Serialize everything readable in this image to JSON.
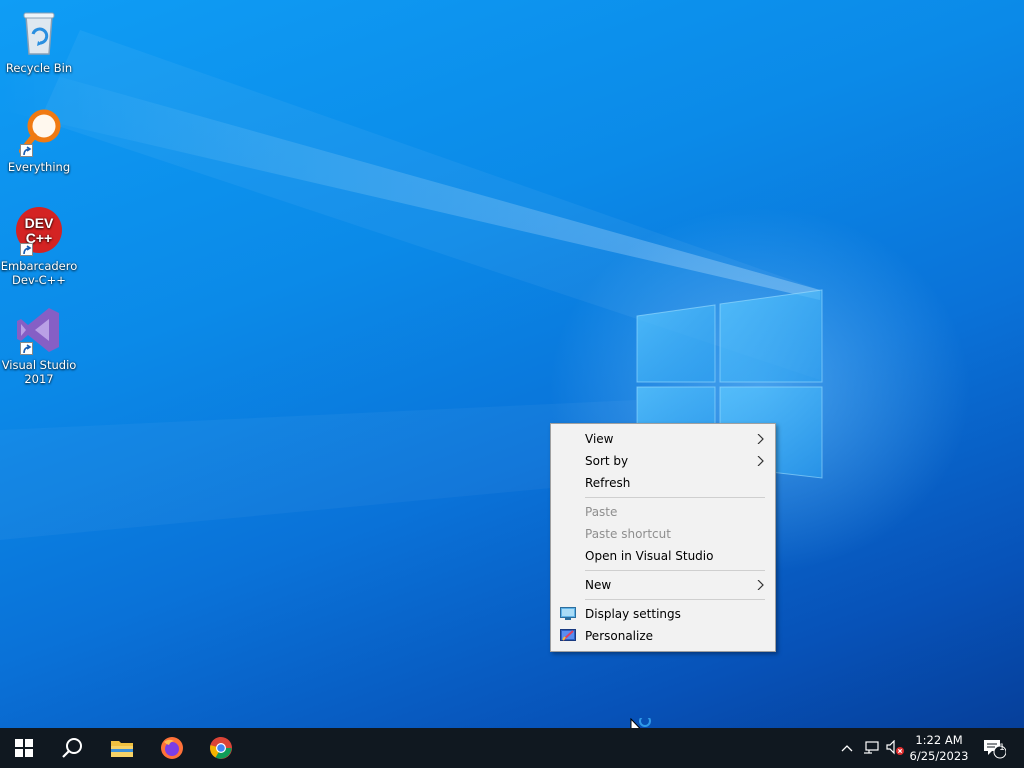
{
  "desktop": {
    "icons": [
      {
        "label": "Recycle Bin",
        "icon": "recycle-bin-icon"
      },
      {
        "label": "Everything",
        "icon": "everything-search-icon"
      },
      {
        "label": "Embarcadero Dev-C++",
        "icon": "dev-cpp-icon",
        "glyph_line1": "DEV",
        "glyph_line2": "C++"
      },
      {
        "label": "Visual Studio 2017",
        "icon": "visual-studio-icon"
      }
    ]
  },
  "context_menu": {
    "items": [
      {
        "label": "View",
        "submenu": true,
        "enabled": true
      },
      {
        "label": "Sort by",
        "submenu": true,
        "enabled": true
      },
      {
        "label": "Refresh",
        "enabled": true
      },
      {
        "label": "Paste",
        "enabled": false
      },
      {
        "label": "Paste shortcut",
        "enabled": false
      },
      {
        "label": "Open in Visual Studio",
        "enabled": true
      },
      {
        "label": "New",
        "submenu": true,
        "enabled": true
      },
      {
        "label": "Display settings",
        "icon": "display-settings-icon",
        "enabled": true
      },
      {
        "label": "Personalize",
        "icon": "personalize-icon",
        "enabled": true
      }
    ]
  },
  "taskbar": {
    "pinned": [
      "start-icon",
      "search-icon",
      "file-explorer-icon",
      "firefox-icon",
      "chrome-icon"
    ],
    "tray": {
      "icons": [
        "show-hidden-icons-chevron",
        "network-icon",
        "volume-muted-icon"
      ],
      "time": "1:22 AM",
      "date": "6/25/2023",
      "notification_count": "1"
    }
  },
  "colors": {
    "taskbar_bg": "#101820",
    "menu_bg": "#f2f2f2",
    "disabled_text": "#8f8f8f"
  }
}
